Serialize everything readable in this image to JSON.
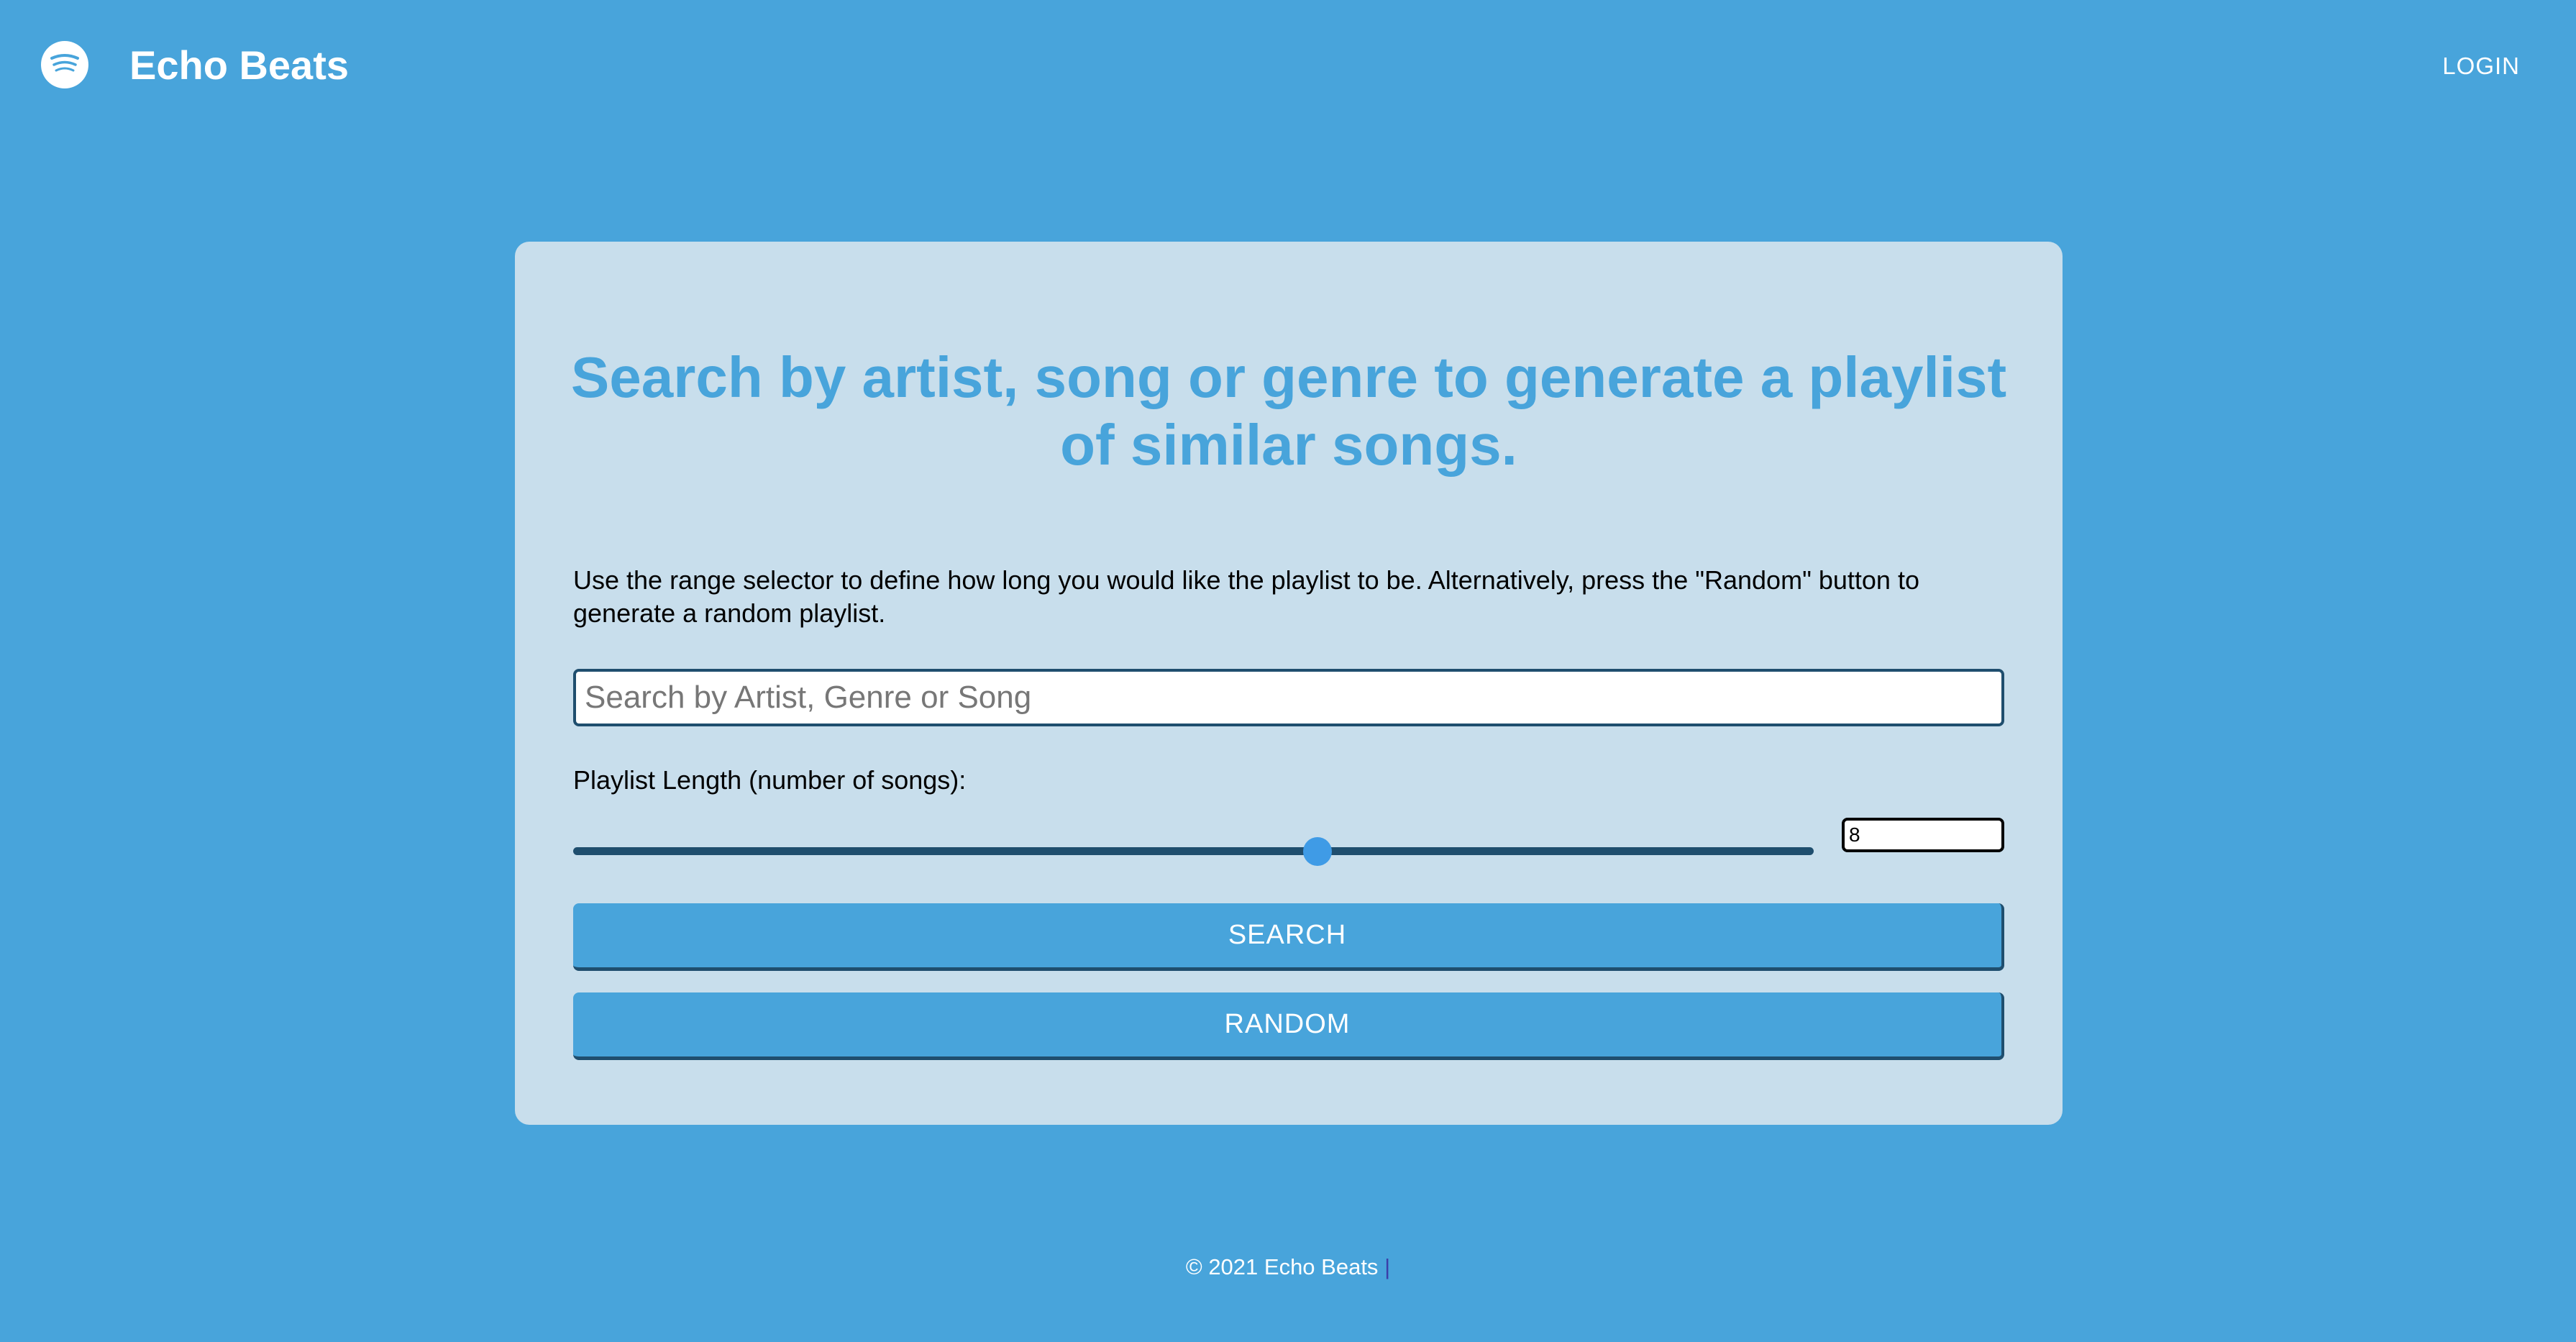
{
  "header": {
    "logo_icon": "spotify-logo-icon",
    "brand": "Echo Beats",
    "login_label": "LOGIN"
  },
  "card": {
    "headline": "Search by artist, song or genre to generate a playlist of similar songs.",
    "instructions": "Use the range selector to define how long you would like the playlist to be. Alternatively, press the \"Random\" button to generate a random playlist.",
    "search_placeholder": "Search by Artist, Genre or Song",
    "search_value": "",
    "length_label": "Playlist Length (number of songs):",
    "slider_level": 0.6,
    "length_value": "8",
    "search_button": "SEARCH",
    "random_button": "RANDOM"
  },
  "footer": {
    "copyright": "© 2021 Echo Beats",
    "separator": "|"
  },
  "colors": {
    "background": "#48a4db",
    "card": "#c8deec",
    "accent": "#48a4db",
    "dark": "#1f4e6e",
    "thumb": "#3f9be6"
  }
}
